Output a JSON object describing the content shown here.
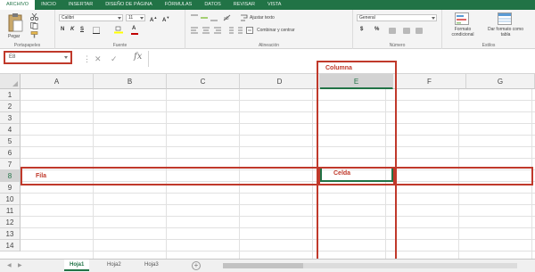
{
  "ribbon_tabs": [
    "ARCHIVO",
    "INICIO",
    "INSERTAR",
    "DISEÑO DE PÁGINA",
    "FÓRMULAS",
    "DATOS",
    "REVISAR",
    "VISTA"
  ],
  "ribbon": {
    "paste_label": "Pegar",
    "clipboard_label": "Portapapeles",
    "font_label": "Fuente",
    "font_name": "Calibri",
    "font_size": "11",
    "alignment_label": "Alineación",
    "wrap_text": "Ajustar texto",
    "merge_center": "Combinar y centrar",
    "number_label": "Número",
    "number_format": "General",
    "conditional_format": "Formato condicional",
    "format_as_table": "Dar formato como tabla",
    "styles_label": "Estilos",
    "bold": "N",
    "italic": "K",
    "underline": "S",
    "currency": "$",
    "percent": "%"
  },
  "formula_bar": {
    "name_box": "E8",
    "fx": "fx",
    "value": ""
  },
  "grid": {
    "columns": [
      "A",
      "B",
      "C",
      "D",
      "E",
      "F",
      "G"
    ],
    "selected_column": "E",
    "rows": [
      "1",
      "2",
      "3",
      "4",
      "5",
      "6",
      "7",
      "8",
      "9",
      "10",
      "11",
      "12",
      "13",
      "14"
    ],
    "selected_row": "8"
  },
  "annotations": {
    "column": "Columna",
    "row": "Fila",
    "cell": "Celda",
    "color": "#c0392b"
  },
  "sheets": [
    "Hoja1",
    "Hoja2",
    "Hoja3"
  ],
  "active_sheet": "Hoja1",
  "colors": {
    "accent": "#217346",
    "highlight": "#c0392b"
  }
}
